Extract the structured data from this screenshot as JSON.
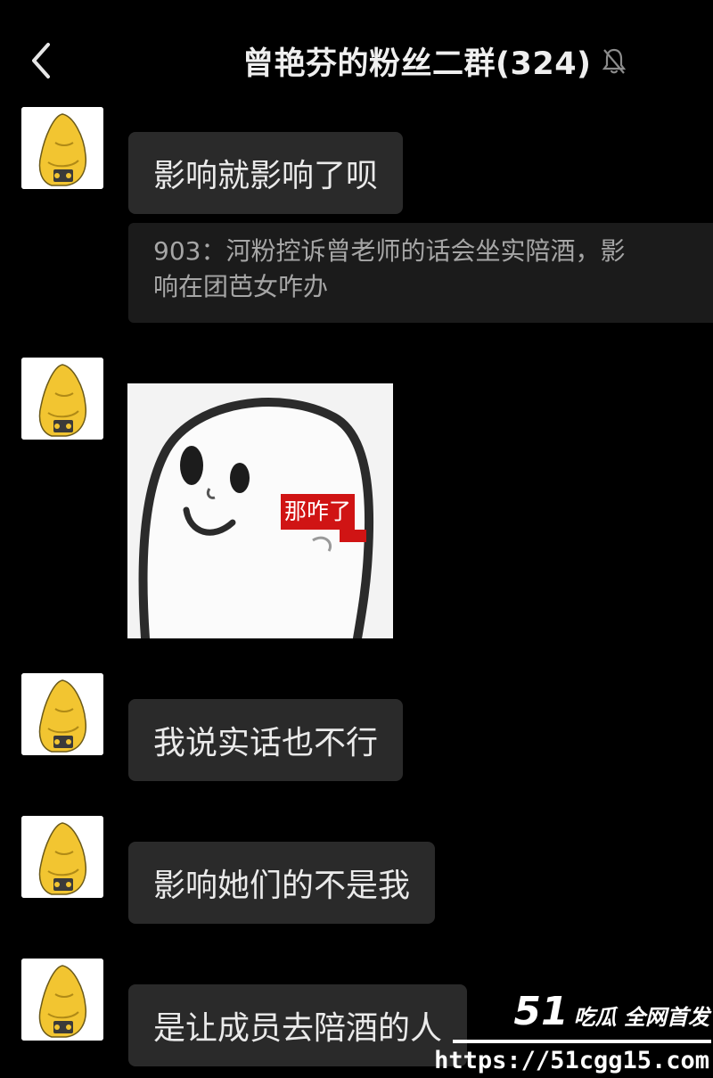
{
  "header": {
    "title": "曾艳芬的粉丝二群(324)",
    "back_icon": "chevron-left-icon",
    "mute_icon": "bell-muted-icon"
  },
  "messages": [
    {
      "kind": "text",
      "text": "影响就影响了呗"
    },
    {
      "kind": "quote",
      "lines": [
        "903：河粉控诉曾老师的话会坐实陪酒，影",
        "响在团芭女咋办"
      ]
    },
    {
      "kind": "sticker",
      "caption": "那咋了"
    },
    {
      "kind": "text",
      "text": "我说实话也不行"
    },
    {
      "kind": "text",
      "text": "影响她们的不是我"
    },
    {
      "kind": "text",
      "text": "是让成员去陪酒的人"
    }
  ],
  "watermark": {
    "logo": "51",
    "tagline": "吃瓜 全网首发",
    "url": "https://51cgg15.com"
  },
  "colors": {
    "background": "#000000",
    "bubble": "#2a2a2a",
    "quote": "#1b1b1b",
    "text": "#eaeaea",
    "quote_text": "#a6a6a6",
    "avatar_yellow": "#f2c531",
    "caption_red": "#d01414"
  }
}
